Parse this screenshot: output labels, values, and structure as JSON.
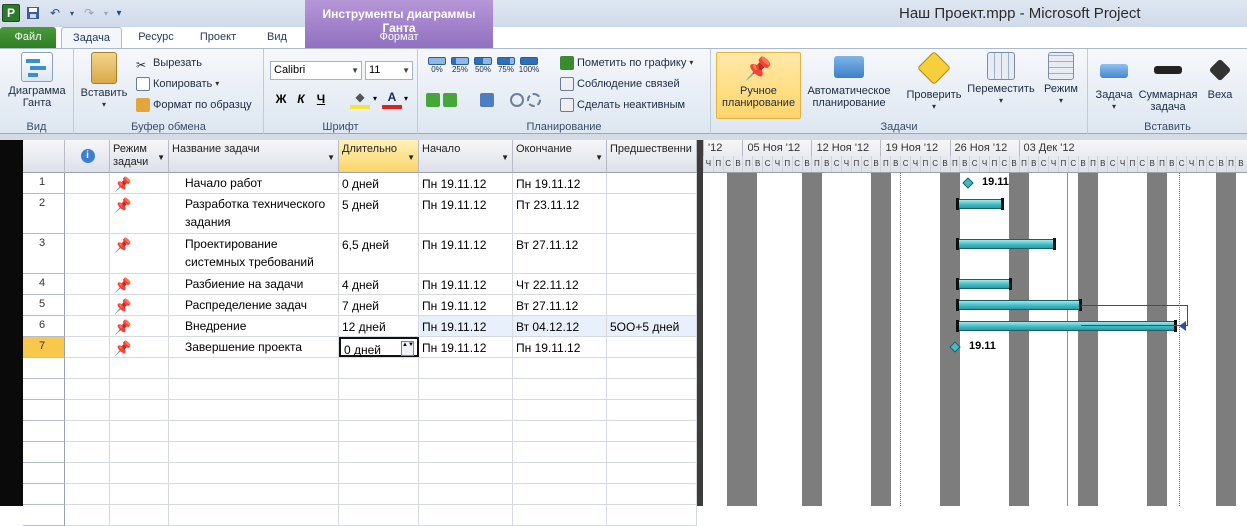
{
  "app": {
    "logo": "P",
    "window_title": "Наш Проект.mpp - Microsoft Project",
    "contextual_title": "Инструменты диаграммы Ганта"
  },
  "qat": {
    "save_icon": "save-icon",
    "undo_icon": "undo-icon",
    "redo_icon": "redo-icon",
    "customize": "▾"
  },
  "tabs": {
    "file": "Файл",
    "task": "Задача",
    "resource": "Ресурс",
    "project": "Проект",
    "view": "Вид",
    "format": "Формат"
  },
  "ribbon": {
    "view_group": {
      "label": "Вид",
      "gantt_btn": "Диаграмма\nГанта"
    },
    "clipboard": {
      "label": "Буфер обмена",
      "paste": "Вставить",
      "cut": "Вырезать",
      "copy": "Копировать",
      "format_painter": "Формат по образцу"
    },
    "font": {
      "label": "Шрифт",
      "font_name": "Calibri",
      "font_size": "11",
      "bold": "Ж",
      "italic": "К",
      "underline": "Ч"
    },
    "schedule": {
      "label": "Планирование",
      "pct": [
        "0%",
        "25%",
        "50%",
        "75%",
        "100%"
      ],
      "mark_on_track": "Пометить по графику",
      "respect_links": "Соблюдение связей",
      "inactivate": "Сделать неактивным"
    },
    "tasks": {
      "label": "Задачи",
      "manual": "Ручное\nпланирование",
      "auto": "Автоматическое\nпланирование",
      "inspect": "Проверить",
      "move": "Переместить",
      "mode": "Режим"
    },
    "insert": {
      "label": "Вставить",
      "task": "Задача",
      "summary": "Суммарная\nзадача",
      "milestone": "Веха"
    }
  },
  "columns": {
    "info": "i",
    "mode": "Режим\nзадачи",
    "name": "Название задачи",
    "duration": "Длительно",
    "start": "Начало",
    "finish": "Окончание",
    "predecessors": "Предшественни"
  },
  "tasks": [
    {
      "id": "1",
      "name": "Начало работ",
      "duration": "0 дней",
      "start": "Пн 19.11.12",
      "finish": "Пн 19.11.12",
      "pred": ""
    },
    {
      "id": "2",
      "name": "Разработка технического задания",
      "duration": "5 дней",
      "start": "Пн 19.11.12",
      "finish": "Пт 23.11.12",
      "pred": ""
    },
    {
      "id": "3",
      "name": "Проектирование системных требований",
      "duration": "6,5 дней",
      "start": "Пн 19.11.12",
      "finish": "Вт 27.11.12",
      "pred": ""
    },
    {
      "id": "4",
      "name": "Разбиение на задачи",
      "duration": "4 дней",
      "start": "Пн 19.11.12",
      "finish": "Чт 22.11.12",
      "pred": ""
    },
    {
      "id": "5",
      "name": "Распределение задач",
      "duration": "7 дней",
      "start": "Пн 19.11.12",
      "finish": "Вт 27.11.12",
      "pred": ""
    },
    {
      "id": "6",
      "name": "Внедрение",
      "duration": "12 дней",
      "start": "Пн 19.11.12",
      "finish": "Вт 04.12.12",
      "pred": "5ОО+5 дней"
    },
    {
      "id": "7",
      "name": "Завершение проекта",
      "duration": "0 дней",
      "start": "Пн 19.11.12",
      "finish": "Пн 19.11.12",
      "pred": ""
    }
  ],
  "timescale": {
    "weeks": [
      "'12",
      "05 Ноя '12",
      "12 Ноя '12",
      "19 Ноя '12",
      "26 Ноя '12",
      "03 Дек '12"
    ],
    "days": [
      "Ч",
      "П",
      "С",
      "В",
      "П",
      "В",
      "С",
      "Ч",
      "П",
      "С",
      "В",
      "П",
      "В",
      "С",
      "Ч",
      "П",
      "С",
      "В",
      "П",
      "В",
      "С",
      "Ч",
      "П",
      "С",
      "В",
      "П",
      "В",
      "С",
      "Ч",
      "П",
      "С",
      "В",
      "П",
      "В",
      "С",
      "Ч",
      "П",
      "С",
      "В",
      "П",
      "В",
      "С",
      "Ч",
      "П",
      "С",
      "В",
      "П",
      "В",
      "С",
      "Ч",
      "П",
      "С",
      "В",
      "П",
      "В"
    ]
  },
  "milestones": {
    "m1": "19.11",
    "m7": "19.11"
  }
}
